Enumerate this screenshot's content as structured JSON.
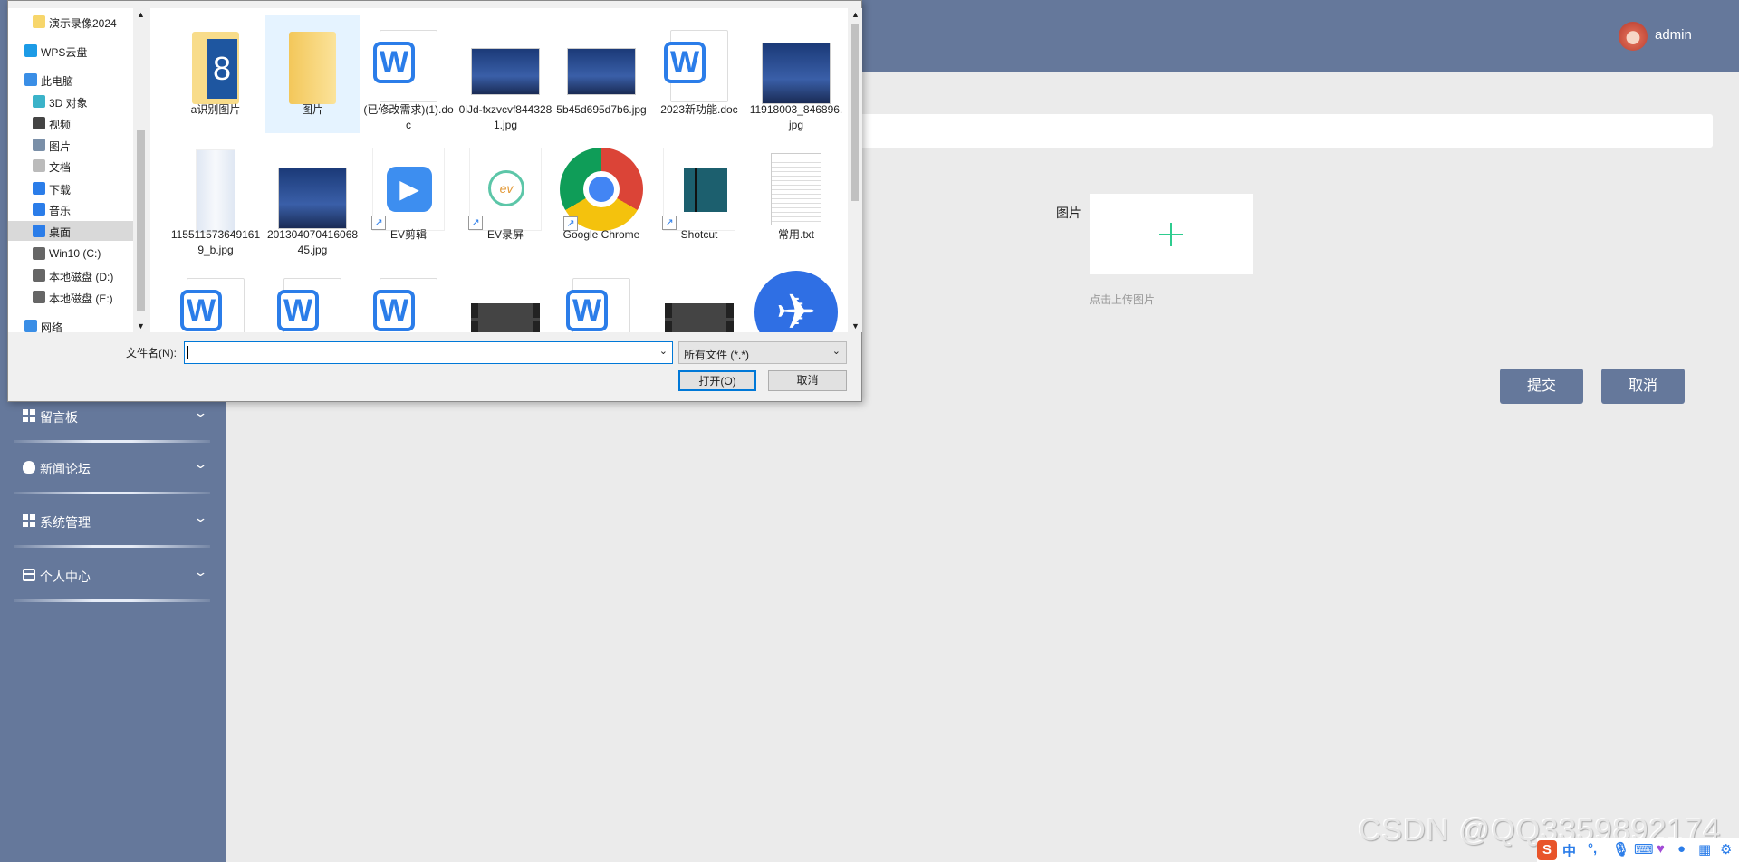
{
  "header": {
    "username": "admin",
    "avatar": "avatar-anime-girl"
  },
  "sidebar": {
    "items": [
      {
        "label": "留言板",
        "icon": "grid-icon"
      },
      {
        "label": "新闻论坛",
        "icon": "bulb-icon"
      },
      {
        "label": "系统管理",
        "icon": "grid-icon"
      },
      {
        "label": "个人中心",
        "icon": "card-icon"
      }
    ]
  },
  "form": {
    "image_label": "图片",
    "upload_hint": "点击上传图片",
    "submit": "提交",
    "cancel": "取消",
    "accent": "#2ecc8f"
  },
  "dialog": {
    "nav": [
      {
        "label": "演示录像2024",
        "icon": "folder-icon",
        "indent": 1
      },
      {
        "label": "WPS云盘",
        "icon": "cloud-icon",
        "indent": 0
      },
      {
        "label": "此电脑",
        "icon": "computer-icon",
        "indent": 0
      },
      {
        "label": "3D 对象",
        "icon": "cube-icon",
        "indent": 1
      },
      {
        "label": "视频",
        "icon": "video-icon",
        "indent": 1
      },
      {
        "label": "图片",
        "icon": "picture-icon",
        "indent": 1
      },
      {
        "label": "文档",
        "icon": "document-icon",
        "indent": 1
      },
      {
        "label": "下载",
        "icon": "download-icon",
        "indent": 1
      },
      {
        "label": "音乐",
        "icon": "music-icon",
        "indent": 1
      },
      {
        "label": "桌面",
        "icon": "desktop-icon",
        "indent": 1,
        "selected": true
      },
      {
        "label": "Win10 (C:)",
        "icon": "drive-icon",
        "indent": 1
      },
      {
        "label": "本地磁盘 (D:)",
        "icon": "drive-icon",
        "indent": 1
      },
      {
        "label": "本地磁盘 (E:)",
        "icon": "drive-icon",
        "indent": 1
      },
      {
        "label": "网络",
        "icon": "network-icon",
        "indent": 0
      }
    ],
    "files": [
      {
        "name": "a识别图片",
        "type": "folder-photo"
      },
      {
        "name": "图片",
        "type": "folder",
        "selected": true
      },
      {
        "name": "(已修改需求)(1).doc",
        "type": "word"
      },
      {
        "name": "0iJd-fxzvcvf8443281.jpg",
        "type": "image"
      },
      {
        "name": "5b45d695d7b6.jpg",
        "type": "image"
      },
      {
        "name": "2023新功能.doc",
        "type": "word"
      },
      {
        "name": "11918003_846896.jpg",
        "type": "image-tall"
      },
      {
        "name": "1155115736491619_b.jpg",
        "type": "bottles"
      },
      {
        "name": "20130407041606845.jpg",
        "type": "image-tall"
      },
      {
        "name": "EV剪辑",
        "type": "ev-edit",
        "shortcut": true
      },
      {
        "name": "EV录屏",
        "type": "ev-record",
        "shortcut": true
      },
      {
        "name": "Google Chrome",
        "type": "chrome",
        "shortcut": true
      },
      {
        "name": "Shotcut",
        "type": "shotcut",
        "shortcut": true
      },
      {
        "name": "常用.txt",
        "type": "txt"
      },
      {
        "name": "",
        "type": "word"
      },
      {
        "name": "",
        "type": "word"
      },
      {
        "name": "",
        "type": "word"
      },
      {
        "name": "",
        "type": "video"
      },
      {
        "name": "",
        "type": "word"
      },
      {
        "name": "",
        "type": "video"
      },
      {
        "name": "",
        "type": "app-blue"
      }
    ],
    "filename_label": "文件名(N):",
    "filename_value": "",
    "filetype": "所有文件 (*.*)",
    "open": "打开(O)",
    "cancel": "取消"
  },
  "watermark": "CSDN @QQ3359892174",
  "ime": {
    "lang": "中",
    "punct": "°,"
  }
}
